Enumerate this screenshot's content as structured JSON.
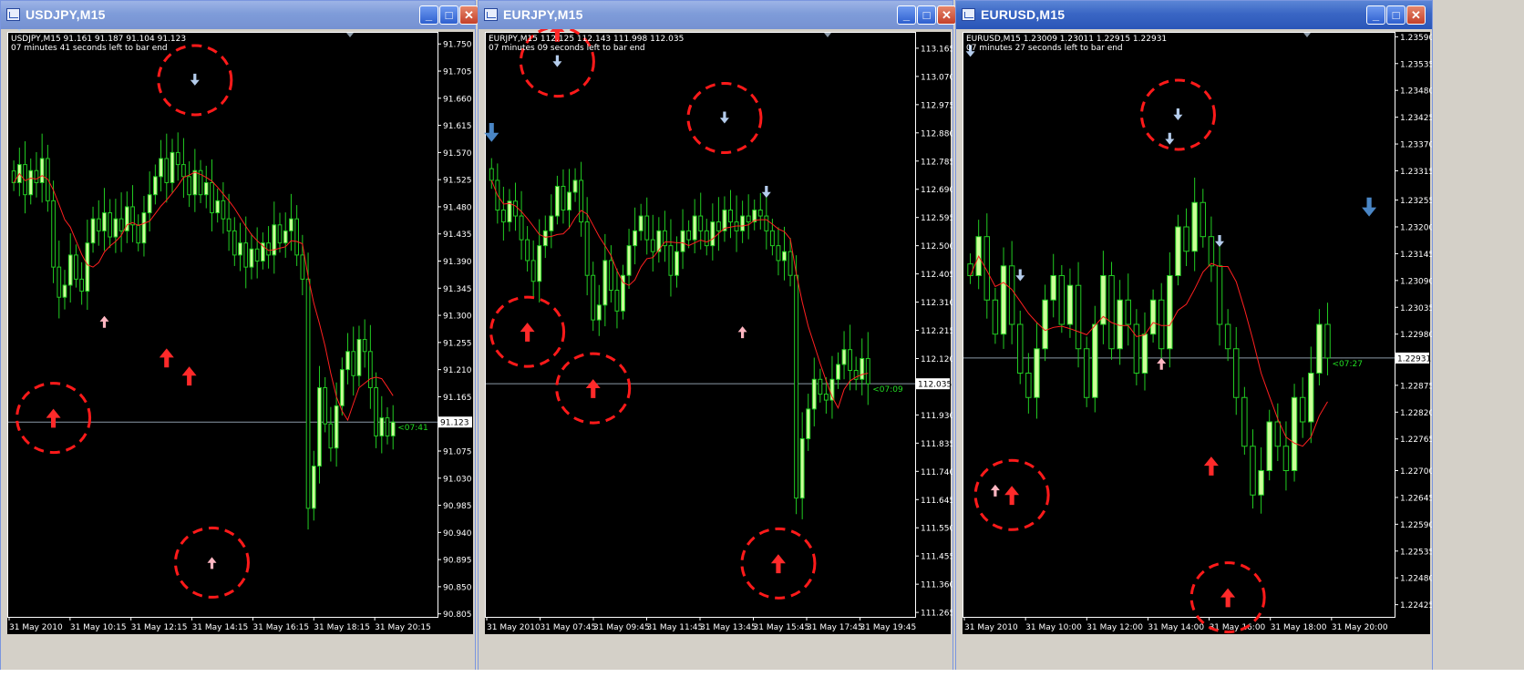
{
  "windows": [
    {
      "title": "USDJPY,M15",
      "header_line1": "USDJPY,M15  91.161 91.187 91.104 91.123",
      "header_line2": "07 minutes 41 seconds left to bar end",
      "countdown": "<07:41",
      "price_label": "91.123",
      "buttons": {
        "minimize": "_",
        "maximize": "□",
        "close": "✕"
      }
    },
    {
      "title": "EURJPY,M15",
      "header_line1": "EURJPY,M15  112.125 112.143 111.998 112.035",
      "header_line2": "07 minutes 09 seconds left to bar end",
      "countdown": "<07:09",
      "price_label": "112.035",
      "buttons": {
        "minimize": "_",
        "maximize": "□",
        "close": "✕"
      }
    },
    {
      "title": "EURUSD,M15",
      "header_line1": "EURUSD,M15  1.23009 1.23011 1.22915 1.22931",
      "header_line2": "07 minutes 27 seconds left to bar end",
      "countdown": "<07:27",
      "price_label": "1.22931",
      "buttons": {
        "minimize": "_",
        "maximize": "□",
        "close": "✕"
      }
    }
  ],
  "colors": {
    "background": "#000000",
    "bull_candle": "#ccff99",
    "bear_candle": "#000000",
    "wick": "#22cc22",
    "moving_average": "#ff2020",
    "bid_line": "#8c9aa8",
    "buy_arrow": "#ff2a2a",
    "buy_arrow_small": "#ffb6c1",
    "sell_arrow": "#4a86c5",
    "sell_arrow_small": "#b4ccec",
    "highlight_circle": "#ff1a1a",
    "countdown_text": "#22dd22",
    "axis_text": "#ffffff"
  },
  "chart_data": [
    {
      "type": "candlestick",
      "symbol": "USDJPY",
      "timeframe": "M15",
      "ohlc": [
        91.161,
        91.187,
        91.104,
        91.123
      ],
      "y_ticks": [
        "91.750",
        "91.705",
        "91.660",
        "91.615",
        "91.570",
        "91.525",
        "91.480",
        "91.435",
        "91.390",
        "91.345",
        "91.300",
        "91.255",
        "91.210",
        "91.165",
        "91.075",
        "91.030",
        "90.985",
        "90.940",
        "90.895",
        "90.850",
        "90.805"
      ],
      "ylim": [
        90.8,
        91.77
      ],
      "x_ticks": [
        "31 May 2010",
        "31 May 10:15",
        "31 May 12:15",
        "31 May 14:15",
        "31 May 16:15",
        "31 May 18:15",
        "31 May 20:15"
      ],
      "bid": 91.123,
      "closes": [
        91.52,
        91.55,
        91.5,
        91.54,
        91.52,
        91.56,
        91.49,
        91.38,
        91.33,
        91.35,
        91.4,
        91.36,
        91.34,
        91.42,
        91.46,
        91.44,
        91.47,
        91.43,
        91.46,
        91.44,
        91.48,
        91.45,
        91.42,
        91.47,
        91.5,
        91.53,
        91.56,
        91.52,
        91.57,
        91.55,
        91.53,
        91.5,
        91.54,
        91.5,
        91.52,
        91.47,
        91.49,
        91.46,
        91.44,
        91.4,
        91.42,
        91.38,
        91.41,
        91.39,
        91.42,
        91.4,
        91.45,
        91.42,
        91.44,
        91.46,
        91.4,
        91.36,
        90.98,
        91.05,
        91.18,
        91.12,
        91.08,
        91.15,
        91.21,
        91.24,
        91.2,
        91.26,
        91.24,
        91.18,
        91.1,
        91.13,
        91.1,
        91.123
      ],
      "ma_period": 8,
      "signals": [
        {
          "i": 1,
          "dir": "sell",
          "size": "small",
          "price": 91.78,
          "circle": false
        },
        {
          "i": 32,
          "dir": "sell",
          "size": "small",
          "price": 91.69,
          "circle": true
        },
        {
          "i": 16,
          "dir": "buy",
          "size": "small",
          "price": 91.29,
          "circle": false
        },
        {
          "i": 27,
          "dir": "buy",
          "size": "big",
          "price": 91.23,
          "circle": false
        },
        {
          "i": 31,
          "dir": "buy",
          "size": "big",
          "price": 91.2,
          "circle": false
        },
        {
          "i": 7,
          "dir": "buy",
          "size": "big",
          "price": 91.13,
          "circle": true
        },
        {
          "i": 35,
          "dir": "buy",
          "size": "small",
          "price": 90.89,
          "circle": true
        }
      ]
    },
    {
      "type": "candlestick",
      "symbol": "EURJPY",
      "timeframe": "M15",
      "ohlc": [
        112.125,
        112.143,
        111.998,
        112.035
      ],
      "y_ticks": [
        "113.165",
        "113.070",
        "112.975",
        "112.880",
        "112.785",
        "112.690",
        "112.595",
        "112.500",
        "112.405",
        "112.310",
        "112.215",
        "112.120",
        "111.930",
        "111.835",
        "111.740",
        "111.645",
        "111.550",
        "111.455",
        "111.360",
        "111.265"
      ],
      "ylim": [
        111.25,
        113.22
      ],
      "x_ticks": [
        "31 May 2010",
        "31 May 07:45",
        "31 May 09:45",
        "31 May 11:45",
        "31 May 13:45",
        "31 May 15:45",
        "31 May 17:45",
        "31 May 19:45"
      ],
      "bid": 112.035,
      "closes": [
        112.72,
        112.62,
        112.58,
        112.65,
        112.6,
        112.52,
        112.45,
        112.38,
        112.5,
        112.55,
        112.6,
        112.7,
        112.62,
        112.68,
        112.72,
        112.58,
        112.4,
        112.25,
        112.3,
        112.45,
        112.35,
        112.28,
        112.4,
        112.5,
        112.55,
        112.6,
        112.52,
        112.48,
        112.55,
        112.5,
        112.4,
        112.48,
        112.55,
        112.52,
        112.6,
        112.55,
        112.5,
        112.58,
        112.55,
        112.62,
        112.58,
        112.55,
        112.6,
        112.58,
        112.62,
        112.6,
        112.55,
        112.5,
        112.45,
        112.48,
        112.4,
        111.65,
        111.85,
        111.95,
        112.05,
        112.0,
        111.98,
        112.05,
        112.1,
        112.15,
        112.08,
        112.05,
        112.12,
        112.035
      ],
      "ma_period": 8,
      "signals": [
        {
          "i": 11,
          "dir": "buy",
          "size": "big",
          "price": 113.22,
          "circle": false
        },
        {
          "i": 11,
          "dir": "sell",
          "size": "small",
          "price": 113.12,
          "circle": true
        },
        {
          "i": 0,
          "dir": "sell",
          "size": "big",
          "price": 112.88,
          "circle": false
        },
        {
          "i": 39,
          "dir": "sell",
          "size": "small",
          "price": 112.93,
          "circle": true
        },
        {
          "i": 46,
          "dir": "sell",
          "size": "small",
          "price": 112.68,
          "circle": false
        },
        {
          "i": 42,
          "dir": "buy",
          "size": "small",
          "price": 112.21,
          "circle": false
        },
        {
          "i": 6,
          "dir": "buy",
          "size": "big",
          "price": 112.21,
          "circle": true
        },
        {
          "i": 17,
          "dir": "buy",
          "size": "big",
          "price": 112.02,
          "circle": true
        },
        {
          "i": 48,
          "dir": "buy",
          "size": "big",
          "price": 111.43,
          "circle": true
        }
      ]
    },
    {
      "type": "candlestick",
      "symbol": "EURUSD",
      "timeframe": "M15",
      "ohlc": [
        1.23009,
        1.23011,
        1.22915,
        1.22931
      ],
      "y_ticks": [
        "1.23590",
        "1.23535",
        "1.23480",
        "1.23425",
        "1.23370",
        "1.23315",
        "1.23255",
        "1.23200",
        "1.23145",
        "1.23090",
        "1.23035",
        "1.22980",
        "1.22875",
        "1.22820",
        "1.22765",
        "1.22700",
        "1.22645",
        "1.22590",
        "1.22535",
        "1.22480",
        "1.22425"
      ],
      "ylim": [
        1.224,
        1.236
      ],
      "x_ticks": [
        "31 May 2010",
        "31 May 10:00",
        "31 May 12:00",
        "31 May 14:00",
        "31 May 16:00",
        "31 May 18:00",
        "31 May 20:00"
      ],
      "bid": 1.22931,
      "closes": [
        1.231,
        1.2318,
        1.2305,
        1.2298,
        1.2312,
        1.23,
        1.229,
        1.2285,
        1.2295,
        1.2305,
        1.231,
        1.23,
        1.2308,
        1.2295,
        1.2285,
        1.23,
        1.231,
        1.2295,
        1.2305,
        1.23,
        1.229,
        1.2298,
        1.2305,
        1.2295,
        1.231,
        1.232,
        1.2315,
        1.2325,
        1.2318,
        1.2312,
        1.23,
        1.2295,
        1.2285,
        1.2275,
        1.2265,
        1.227,
        1.228,
        1.2275,
        1.227,
        1.2285,
        1.228,
        1.229,
        1.23,
        1.22931
      ],
      "ma_period": 8,
      "signals": [
        {
          "i": 0,
          "dir": "sell",
          "size": "small",
          "price": 1.2356,
          "circle": false
        },
        {
          "i": 25,
          "dir": "sell",
          "size": "small",
          "price": 1.2343,
          "circle": true
        },
        {
          "i": 24,
          "dir": "sell",
          "size": "small",
          "price": 1.2338,
          "circle": false
        },
        {
          "i": 48,
          "dir": "sell",
          "size": "big",
          "price": 1.2324,
          "circle": false
        },
        {
          "i": 30,
          "dir": "sell",
          "size": "small",
          "price": 1.2317,
          "circle": false
        },
        {
          "i": 6,
          "dir": "sell",
          "size": "small",
          "price": 1.231,
          "circle": false
        },
        {
          "i": 23,
          "dir": "buy",
          "size": "small",
          "price": 1.2292,
          "circle": false
        },
        {
          "i": 3,
          "dir": "buy",
          "size": "small",
          "price": 1.2266,
          "circle": false
        },
        {
          "i": 5,
          "dir": "buy",
          "size": "big",
          "price": 1.2265,
          "circle": true
        },
        {
          "i": 29,
          "dir": "buy",
          "size": "big",
          "price": 1.2271,
          "circle": false
        },
        {
          "i": 31,
          "dir": "buy",
          "size": "big",
          "price": 1.2244,
          "circle": true
        }
      ]
    }
  ]
}
